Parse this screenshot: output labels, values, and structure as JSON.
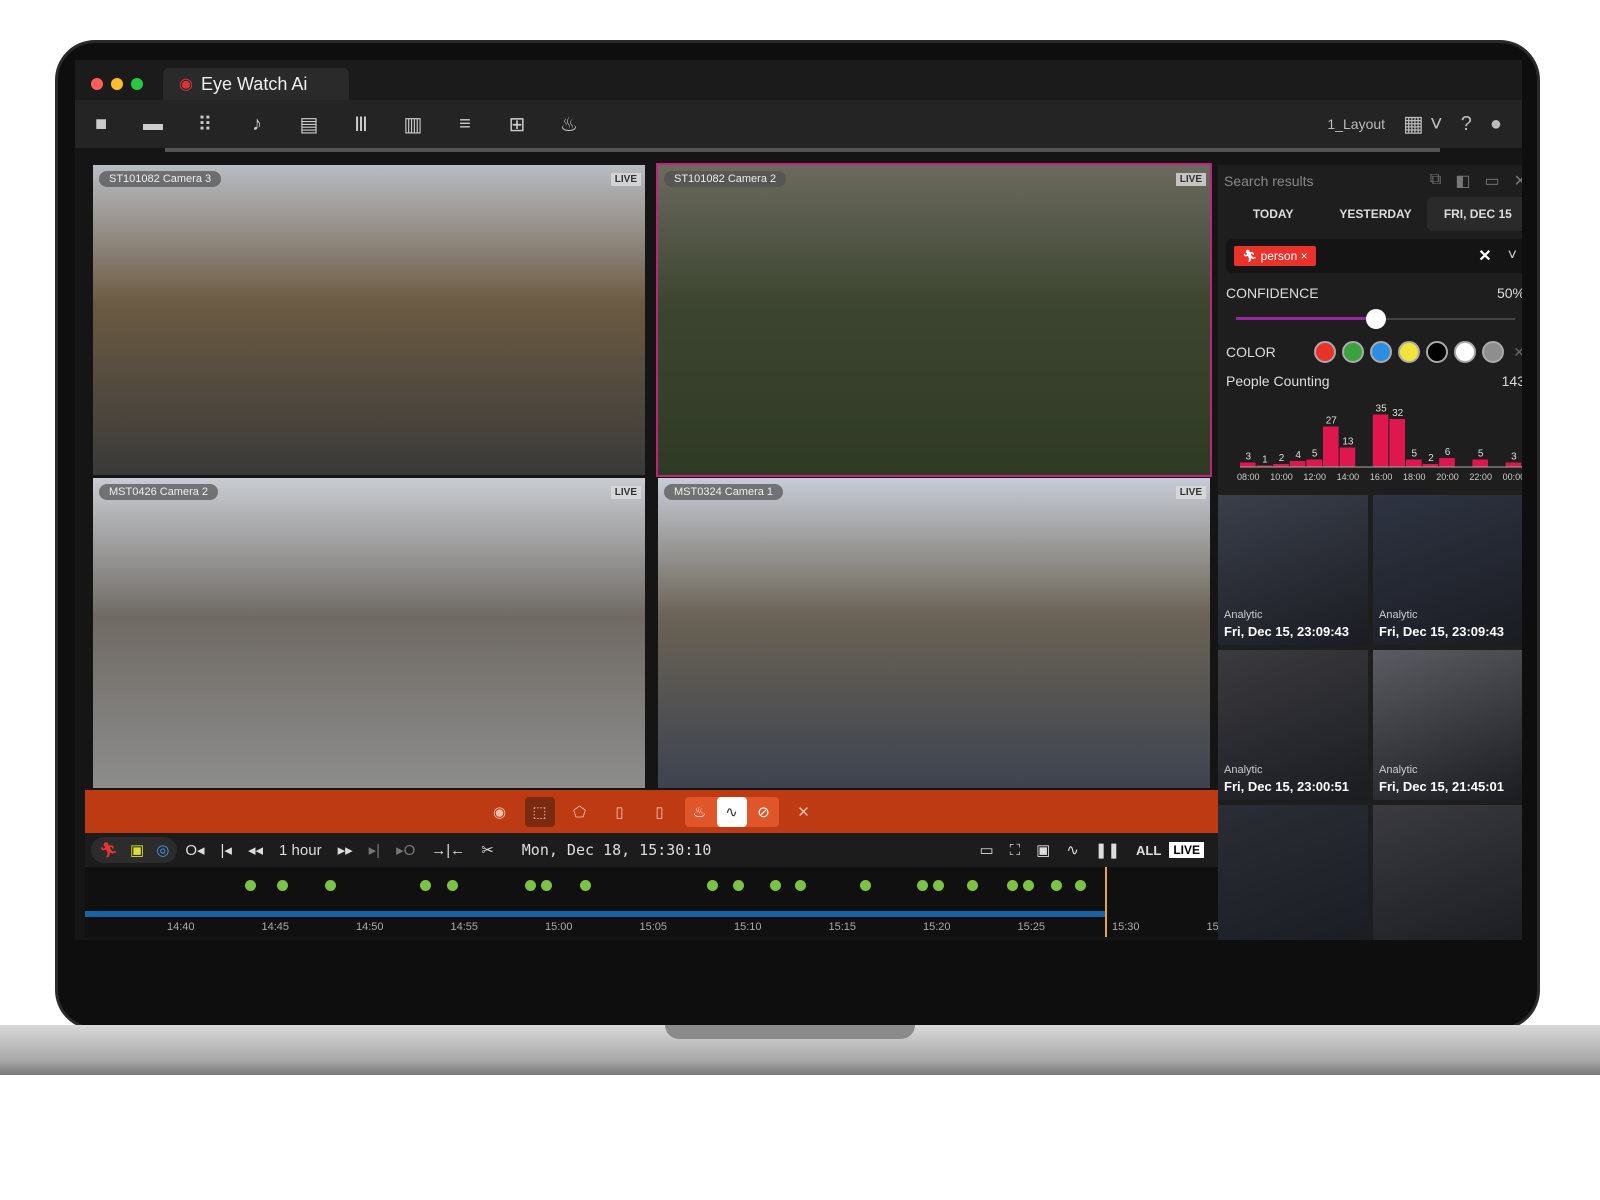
{
  "app": {
    "title": "Eye Watch Ai",
    "layout_label": "1_Layout"
  },
  "toolbar": {
    "icons": [
      "camera-icon",
      "folder-icon",
      "apps-icon",
      "bell-icon",
      "calendar-icon",
      "library-icon",
      "map-icon",
      "list-icon",
      "grid-icon",
      "fire-icon"
    ]
  },
  "cameras": [
    {
      "name": "ST101082 Camera 3",
      "badge": "LIVE",
      "colors": [
        "#b8bcc4",
        "#6b5a42",
        "#3a3a3a"
      ]
    },
    {
      "name": "ST101082 Camera 2",
      "badge": "LIVE",
      "colors": [
        "#6b6a5e",
        "#3c4530",
        "#2f3a25"
      ]
    },
    {
      "name": "MST0426 Camera 2",
      "badge": "LIVE",
      "colors": [
        "#c9ccd2",
        "#6f6a64",
        "#8d8d8d"
      ]
    },
    {
      "name": "MST0324 Camera 1",
      "badge": "LIVE",
      "colors": [
        "#c7ccd6",
        "#6a6255",
        "#3d4350"
      ]
    }
  ],
  "panel": {
    "title": "Search results",
    "tabs": [
      "TODAY",
      "YESTERDAY",
      "FRI, DEC 15"
    ],
    "active_tab": 2,
    "filter_tag": "person",
    "filter_tag_color": "#e8322a",
    "confidence_label": "CONFIDENCE",
    "confidence_value": "50%",
    "confidence": 50,
    "color_label": "COLOR",
    "colors": [
      "#e8322a",
      "#3aa23f",
      "#2b8ee0",
      "#f2e43a",
      "#000000",
      "#ffffff",
      "#8e8e8e"
    ],
    "people_label": "People Counting",
    "people_total": "143",
    "results": [
      {
        "label": "Analytic",
        "time": "Fri, Dec 15, 23:09:43"
      },
      {
        "label": "Analytic",
        "time": "Fri, Dec 15, 23:09:43"
      },
      {
        "label": "Analytic",
        "time": "Fri, Dec 15, 23:00:51"
      },
      {
        "label": "Analytic",
        "time": "Fri, Dec 15, 21:45:01"
      },
      {
        "label": "",
        "time": ""
      },
      {
        "label": "",
        "time": ""
      }
    ]
  },
  "chart_data": {
    "type": "bar",
    "color": "#e0174f",
    "categories": [
      "08:00",
      "09:00",
      "10:00",
      "11:00",
      "12:00",
      "13:00",
      "14:00",
      "15:00",
      "16:00",
      "17:00",
      "18:00",
      "19:00",
      "20:00",
      "21:00",
      "22:00",
      "23:00",
      "00:00"
    ],
    "values": [
      3,
      1,
      2,
      4,
      5,
      27,
      13,
      0,
      35,
      32,
      5,
      2,
      6,
      0,
      5,
      0,
      3
    ],
    "tick_labels": [
      "08:00",
      "10:00",
      "12:00",
      "14:00",
      "16:00",
      "18:00",
      "20:00",
      "22:00",
      "00:00"
    ]
  },
  "playback": {
    "interval": "1 hour",
    "datetime": "Mon, Dec 18, 15:30:10",
    "all_label": "ALL",
    "live_label": "LIVE",
    "time_ticks": [
      "14:40",
      "14:45",
      "14:50",
      "14:55",
      "15:00",
      "15:05",
      "15:10",
      "15:15",
      "15:20",
      "15:25",
      "15:30",
      "15"
    ]
  }
}
